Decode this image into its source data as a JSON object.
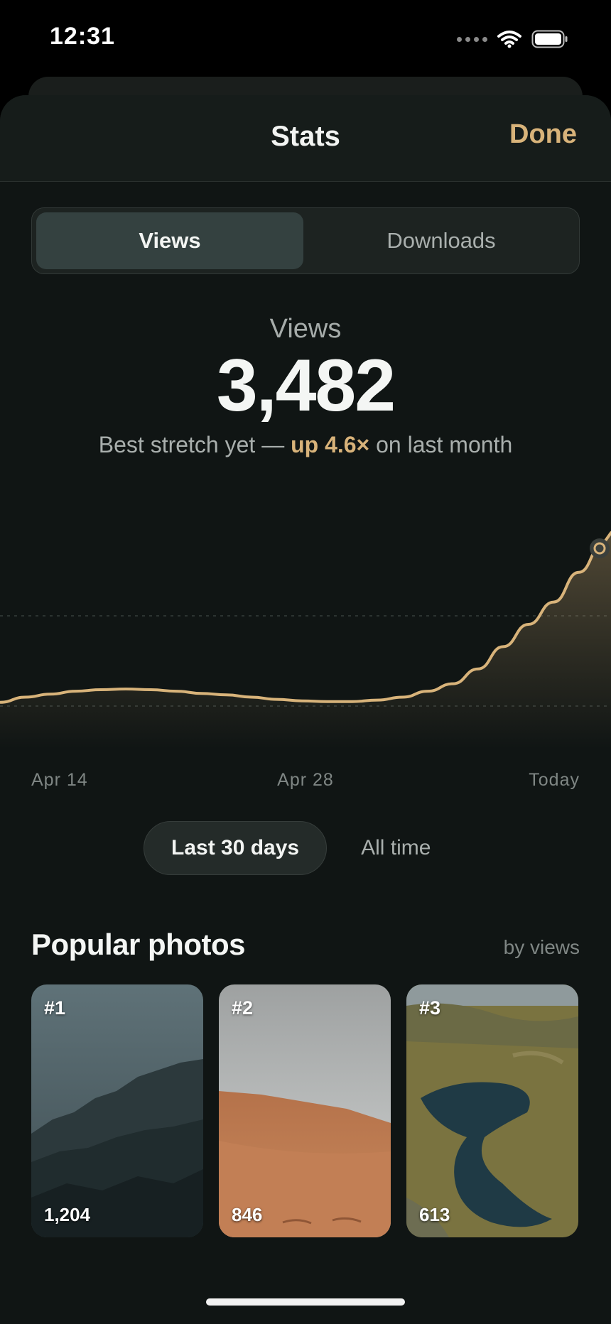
{
  "status_bar": {
    "time": "12:31"
  },
  "nav": {
    "title": "Stats",
    "done_label": "Done"
  },
  "segments": {
    "active": "Views",
    "inactive": "Downloads"
  },
  "metric": {
    "label": "Views",
    "value": "3,482",
    "sub_prefix": "Best stretch yet — ",
    "sub_highlight": "up 4.6×",
    "sub_suffix": " on last month"
  },
  "chart_data": {
    "type": "area",
    "x_tick_labels": [
      "Apr 14",
      "Apr 28",
      "Today"
    ],
    "series": [
      {
        "values": [
          0.05,
          0.12,
          0.16,
          0.2,
          0.22,
          0.23,
          0.22,
          0.2,
          0.17,
          0.15,
          0.12,
          0.09,
          0.07,
          0.06,
          0.06,
          0.08,
          0.12,
          0.2,
          0.3,
          0.5,
          0.8,
          1.1,
          1.4,
          1.8,
          2.2
        ]
      }
    ],
    "grid": true,
    "line_color": "#d8b37a",
    "fill_color": "#d8b37a"
  },
  "range": {
    "active": "Last 30 days",
    "inactive": "All time"
  },
  "popular": {
    "title": "Popular photos",
    "meta": "by views",
    "photos": [
      {
        "rank": "#1",
        "views": "1,204"
      },
      {
        "rank": "#2",
        "views": "846"
      },
      {
        "rank": "#3",
        "views": "613"
      }
    ]
  }
}
